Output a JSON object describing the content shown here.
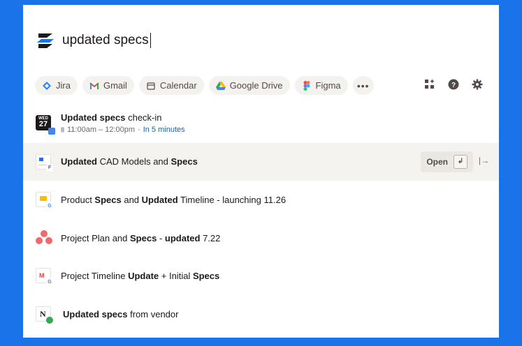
{
  "search": {
    "query": "updated specs"
  },
  "filters": [
    {
      "label": "Jira",
      "icon": "jira-icon"
    },
    {
      "label": "Gmail",
      "icon": "gmail-icon"
    },
    {
      "label": "Calendar",
      "icon": "calendar-icon"
    },
    {
      "label": "Google Drive",
      "icon": "google-drive-icon"
    },
    {
      "label": "Figma",
      "icon": "figma-icon"
    }
  ],
  "results": [
    {
      "parts": [
        {
          "t": "Updated specs",
          "b": true
        },
        {
          "t": " check-in",
          "b": false
        }
      ],
      "time": "11:00am – 12:00pm",
      "soon": "In 5 minutes",
      "cal_day": "WED",
      "cal_date": "27"
    },
    {
      "parts": [
        {
          "t": "Updated",
          "b": true
        },
        {
          "t": " CAD Models and ",
          "b": false
        },
        {
          "t": "Specs",
          "b": true
        }
      ]
    },
    {
      "parts": [
        {
          "t": "Product ",
          "b": false
        },
        {
          "t": "Specs",
          "b": true
        },
        {
          "t": " and ",
          "b": false
        },
        {
          "t": "Updated",
          "b": true
        },
        {
          "t": " Timeline - launching 11.26",
          "b": false
        }
      ]
    },
    {
      "parts": [
        {
          "t": "Project Plan and ",
          "b": false
        },
        {
          "t": "Specs",
          "b": true
        },
        {
          "t": " - ",
          "b": false
        },
        {
          "t": "updated",
          "b": true
        },
        {
          "t": " 7.22",
          "b": false
        }
      ]
    },
    {
      "parts": [
        {
          "t": "Project Timeline ",
          "b": false
        },
        {
          "t": "Update",
          "b": true
        },
        {
          "t": " + Initial ",
          "b": false
        },
        {
          "t": "Specs",
          "b": true
        }
      ]
    },
    {
      "parts": [
        {
          "t": "Updated specs",
          "b": true
        },
        {
          "t": " from vendor",
          "b": false
        }
      ]
    }
  ],
  "actions": {
    "open_label": "Open"
  },
  "colors": {
    "background": "#1a73e8",
    "panel": "#ffffff",
    "highlight_row": "#f5f3f0",
    "accent_time": "#1a5fa8"
  }
}
